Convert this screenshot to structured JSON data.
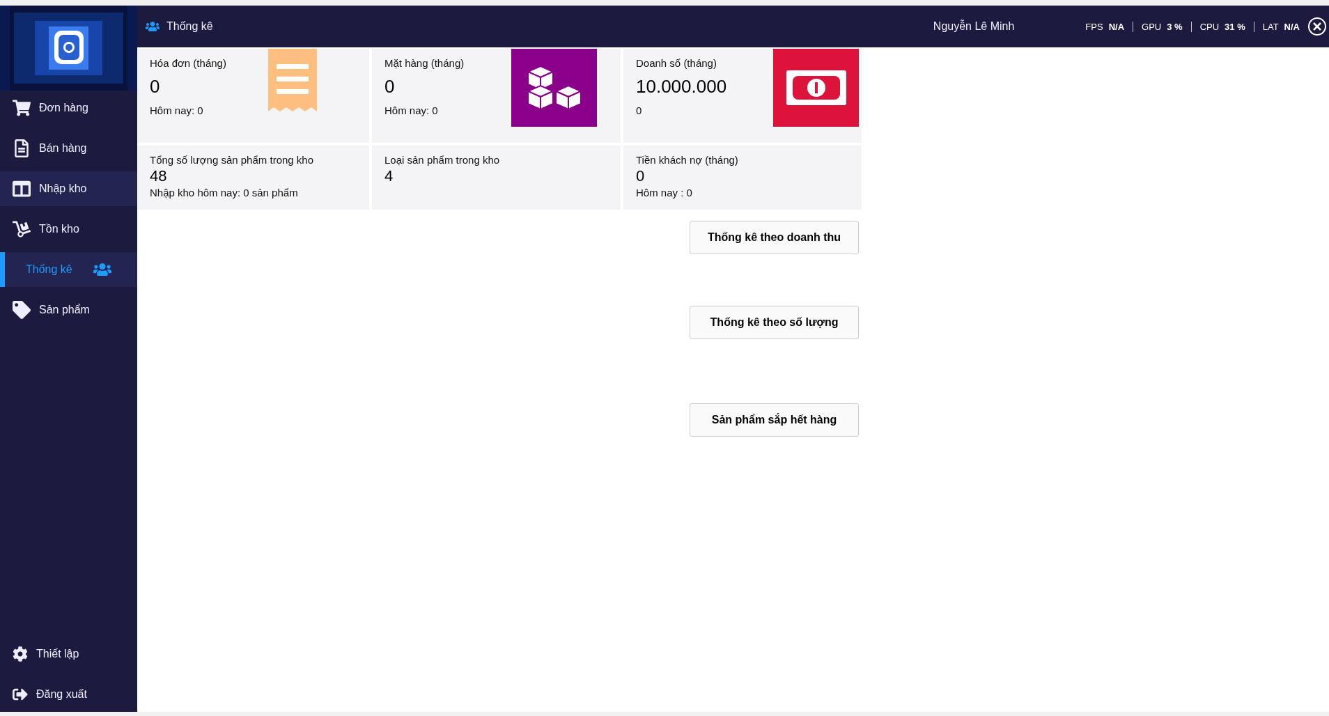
{
  "sidebar": {
    "items": [
      {
        "label": "Đơn hàng",
        "kind": "cart",
        "selected": false,
        "hovered": false
      },
      {
        "label": "Bán hàng",
        "kind": "document",
        "selected": false,
        "hovered": false
      },
      {
        "label": "Nhập kho",
        "kind": "columns",
        "selected": false,
        "hovered": true
      },
      {
        "label": "Tồn kho",
        "kind": "dolly",
        "selected": false,
        "hovered": false
      },
      {
        "label": "Thống kê",
        "kind": "people",
        "selected": true,
        "hovered": false
      },
      {
        "label": "Sản phẩm",
        "kind": "tag",
        "selected": false,
        "hovered": false
      }
    ],
    "bottom_items": [
      {
        "label": "Thiết lập",
        "kind": "gear"
      },
      {
        "label": "Đăng xuất",
        "kind": "logout"
      }
    ]
  },
  "topbar": {
    "title": "Thống kê",
    "user": "Nguyễn Lê Minh"
  },
  "overlay": [
    {
      "label": "FPS",
      "value": "N/A"
    },
    {
      "label": "GPU",
      "value": "3 %"
    },
    {
      "label": "CPU",
      "value": "31 %"
    },
    {
      "label": "LAT",
      "value": "N/A"
    }
  ],
  "cards": [
    {
      "title": "Hóa đơn (tháng)",
      "value": "0",
      "sub": "Hôm nay: 0",
      "kind": "receipt",
      "color": "#ffc07f"
    },
    {
      "title": "Mặt hàng (tháng)",
      "value": "0",
      "sub": "Hôm nay: 0",
      "kind": "cubes",
      "color": "#8b008b"
    },
    {
      "title": "Doanh số (tháng)",
      "value": "10.000.000",
      "sub": "0",
      "kind": "money",
      "color": "#dc143c"
    }
  ],
  "stats": [
    {
      "title": "Tổng số lượng sản phẩm trong kho",
      "value": "48",
      "sub": "Nhập kho hôm nay: 0 sản phẩm"
    },
    {
      "title": "Loại sản phẩm trong kho",
      "value": "4"
    },
    {
      "title": "Tiền khách nợ (tháng)",
      "value": "0",
      "sub": "Hôm nay : 0"
    }
  ],
  "buttons": [
    "Thống kê theo doanh thu",
    "Thống kê theo số lượng",
    "Sản phẩm sắp hết hàng"
  ]
}
